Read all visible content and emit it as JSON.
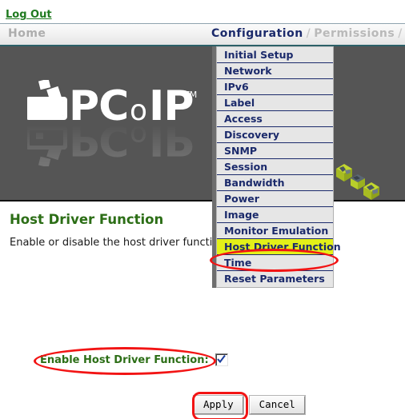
{
  "topbar": {
    "logout_label": "Log Out"
  },
  "nav": {
    "home_label": "Home",
    "active_label": "Configuration",
    "separator": "/",
    "next_label": "Permissions",
    "trailing_separator": "/"
  },
  "hero": {
    "logo_text": "PCoIP",
    "logo_trademark": "TM"
  },
  "menu": {
    "items": [
      {
        "label": "Initial Setup",
        "highlighted": false
      },
      {
        "label": "Network",
        "highlighted": false
      },
      {
        "label": "IPv6",
        "highlighted": false
      },
      {
        "label": "Label",
        "highlighted": false
      },
      {
        "label": "Access",
        "highlighted": false
      },
      {
        "label": "Discovery",
        "highlighted": false
      },
      {
        "label": "SNMP",
        "highlighted": false
      },
      {
        "label": "Session",
        "highlighted": false
      },
      {
        "label": "Bandwidth",
        "highlighted": false
      },
      {
        "label": "Power",
        "highlighted": false
      },
      {
        "label": "Image",
        "highlighted": false
      },
      {
        "label": "Monitor Emulation",
        "highlighted": false
      },
      {
        "label": "Host Driver Function",
        "highlighted": true
      },
      {
        "label": "Time",
        "highlighted": false
      },
      {
        "label": "Reset Parameters",
        "highlighted": false
      }
    ]
  },
  "main": {
    "title": "Host Driver Function",
    "description": "Enable or disable the host driver function.",
    "field_label": "Enable Host Driver Function:",
    "checkbox_checked": "checked",
    "apply_label": "Apply",
    "cancel_label": "Cancel"
  },
  "colors": {
    "accent_green": "#2c6e16",
    "nav_active_blue": "#1b2a6b",
    "menu_highlight": "#e3f018",
    "annotation_red": "#f21414",
    "hero_gray": "#555555",
    "teal_rule": "#2c6068"
  }
}
